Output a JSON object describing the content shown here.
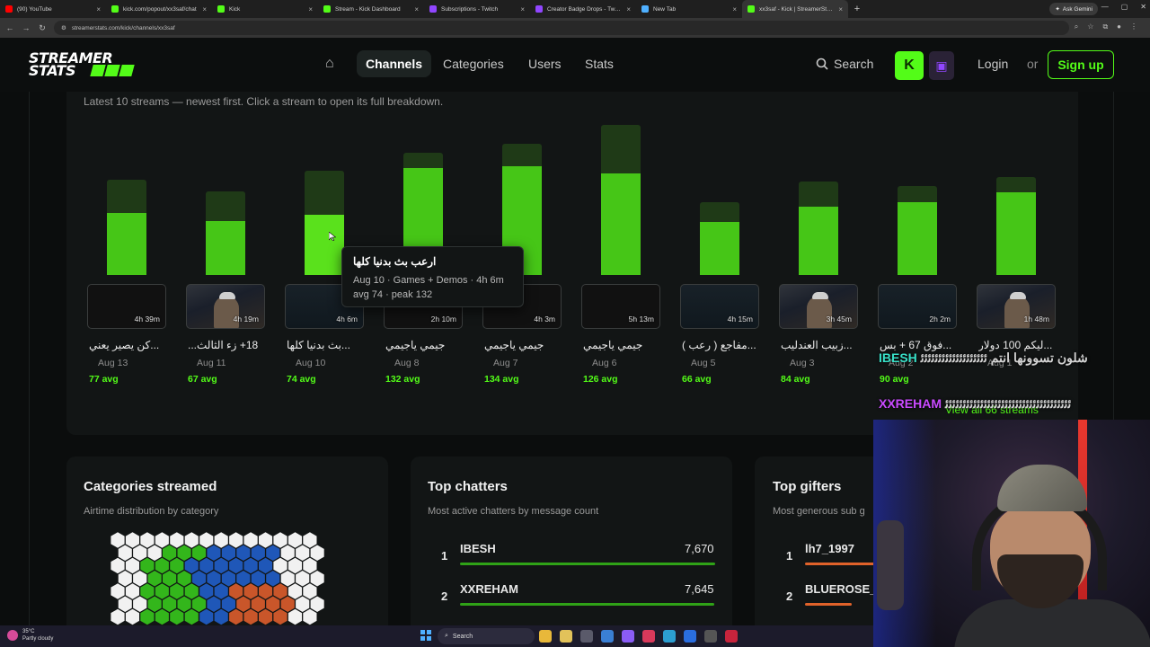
{
  "browser": {
    "tabs": [
      {
        "label": "(90) YouTube",
        "color": "#ff0000",
        "active": false
      },
      {
        "label": "kick.com/popout/xx3saf/chat",
        "color": "#53fc18",
        "active": false
      },
      {
        "label": "Kick",
        "color": "#53fc18",
        "active": false
      },
      {
        "label": "Stream - Kick Dashboard",
        "color": "#53fc18",
        "active": false
      },
      {
        "label": "Subscriptions - Twitch",
        "color": "#9146ff",
        "active": false
      },
      {
        "label": "Creator Badge Drops - Twitch",
        "color": "#9146ff",
        "active": false
      },
      {
        "label": "New Tab",
        "color": "#4fb0ff",
        "active": false
      },
      {
        "label": "xx3saf - Kick | StreamerStats",
        "color": "#53fc18",
        "active": true
      }
    ],
    "new_tab": "+",
    "gemini": "Ask Gemini",
    "url": "streamerstats.com/kick/channels/xx3saf"
  },
  "header": {
    "logo_line1": "STREAMER",
    "logo_line2": "STATS",
    "nav": [
      "Channels",
      "Categories",
      "Users",
      "Stats"
    ],
    "active_nav": "Channels",
    "search": "Search",
    "login": "Login",
    "or": "or",
    "signup": "Sign up"
  },
  "streams_section": {
    "subtitle": "Latest 10 streams — newest first. Click a stream to open its full breakdown.",
    "streams": [
      {
        "title": "...كن يصير يعني",
        "date": "Aug 13",
        "avg_label": "77 avg",
        "duration": "4h 39m",
        "avg": 77,
        "peak": 120,
        "thumb": "blank"
      },
      {
        "title": "18+ زء الثالث...",
        "date": "Aug 11",
        "avg_label": "67 avg",
        "duration": "4h 19m",
        "avg": 67,
        "peak": 106,
        "thumb": "person"
      },
      {
        "title": "...بث بدنيا كلها",
        "date": "Aug 10",
        "avg_label": "74 avg",
        "duration": "4h 6m",
        "avg": 74,
        "peak": 132,
        "thumb": "screen"
      },
      {
        "title": "جيمي ياجيمي",
        "date": "Aug 8",
        "avg_label": "132 avg",
        "duration": "2h 10m",
        "avg": 132,
        "peak": 154,
        "thumb": "blank"
      },
      {
        "title": "جيمي ياجيمي",
        "date": "Aug 7",
        "avg_label": "134 avg",
        "duration": "4h 3m",
        "avg": 134,
        "peak": 166,
        "thumb": "blank"
      },
      {
        "title": "جيمي ياجيمي",
        "date": "Aug 6",
        "avg_label": "126 avg",
        "duration": "5h 13m",
        "avg": 126,
        "peak": 190,
        "thumb": "blank"
      },
      {
        "title": "...مفاجع ( رعب )",
        "date": "Aug 5",
        "avg_label": "66 avg",
        "duration": "4h 15m",
        "avg": 66,
        "peak": 92,
        "thumb": "screen"
      },
      {
        "title": "...زبيب العندليب",
        "date": "Aug 3",
        "avg_label": "84 avg",
        "duration": "3h 45m",
        "avg": 84,
        "peak": 118,
        "thumb": "person"
      },
      {
        "title": "...فوق 67 + بس",
        "date": "Aug 2",
        "avg_label": "90 avg",
        "duration": "2h 2m",
        "avg": 90,
        "peak": 112,
        "thumb": "screen"
      },
      {
        "title": "...ليكم 100 دولار",
        "date": "Aug 1",
        "avg_label": "",
        "duration": "1h 48m",
        "avg": 102,
        "peak": 124,
        "thumb": "person"
      }
    ],
    "tooltip": {
      "title": "ارعب بث بدنيا كلها",
      "meta": "Aug 10 · Games + Demos · 4h 6m",
      "stats": "avg 74 · peak 132"
    },
    "view_all": "View all 66 streams"
  },
  "categories_card": {
    "title": "Categories streamed",
    "subtitle": "Airtime distribution by category",
    "colors": {
      "green": "#33b61b",
      "blue": "#1f57b8",
      "orange": "#c9562a",
      "white": "#f1f1f1"
    }
  },
  "chatters_card": {
    "title": "Top chatters",
    "subtitle": "Most active chatters by message count",
    "rows": [
      {
        "rank": "1",
        "name": "IBESH",
        "value": "7,670",
        "fraction": 1.0
      },
      {
        "rank": "2",
        "name": "XXREHAM",
        "value": "7,645",
        "fraction": 0.997
      }
    ]
  },
  "gifters_card": {
    "title": "Top gifters",
    "subtitle": "Most generous sub g",
    "rows": [
      {
        "rank": "1",
        "name": "lh7_1997",
        "fraction": 0.3
      },
      {
        "rank": "2",
        "name": "BLUEROSE_3",
        "fraction": 0.2
      }
    ]
  },
  "overlay_chat": [
    {
      "user": "IBESH",
      "msg": "شلون تسوونها انتم ﺋﺋﺋﺋﺋﺋﺋﺋﺋﺋﺋﺋﺋﺋﺋﺋﺋﺋﺋ"
    },
    {
      "user": "XXREHAM",
      "msg": "ﺋﺋﺋﺋﺋﺋﺋﺋﺋﺋﺋﺋﺋﺋﺋﺋﺋﺋﺋﺋﺋﺋﺋﺋﺋﺋﺋﺋﺋﺋﺋﺋﺋﺋﺋﺋ"
    }
  ],
  "taskbar": {
    "temp": "35°C",
    "weather": "Partly cloudy",
    "search": "Search"
  }
}
